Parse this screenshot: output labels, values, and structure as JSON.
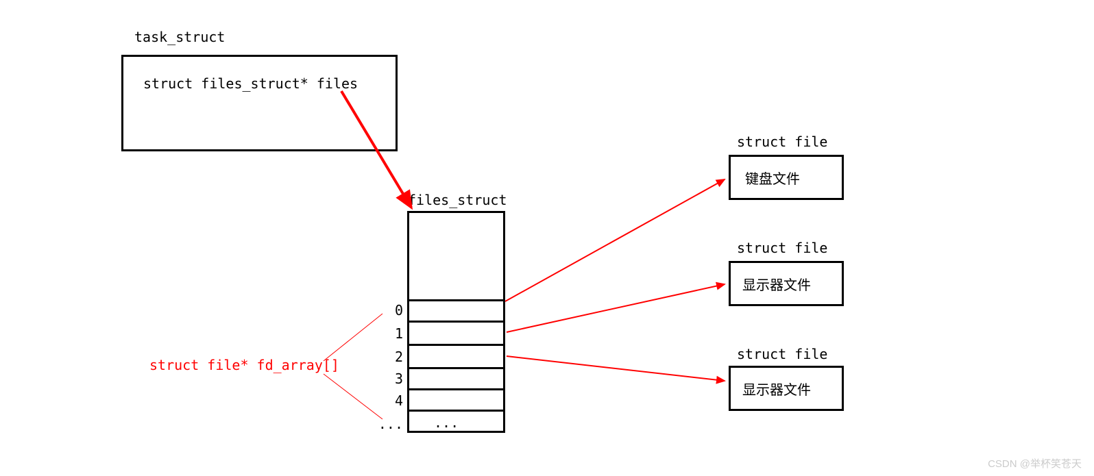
{
  "task_struct": {
    "title": "task_struct",
    "field": "struct files_struct* files"
  },
  "files_struct": {
    "title": "files_struct",
    "fd_array_label": "struct file* fd_array[]",
    "indices": [
      "0",
      "1",
      "2",
      "3",
      "4",
      "..."
    ],
    "ellipsis": "..."
  },
  "files": [
    {
      "title": "struct file",
      "name": "键盘文件"
    },
    {
      "title": "struct file",
      "name": "显示器文件"
    },
    {
      "title": "struct file",
      "name": "显示器文件"
    }
  ],
  "watermark": "CSDN @举杯笑苍天",
  "colors": {
    "arrow": "#ff0000",
    "border": "#000000",
    "red_text": "#ff0000"
  }
}
